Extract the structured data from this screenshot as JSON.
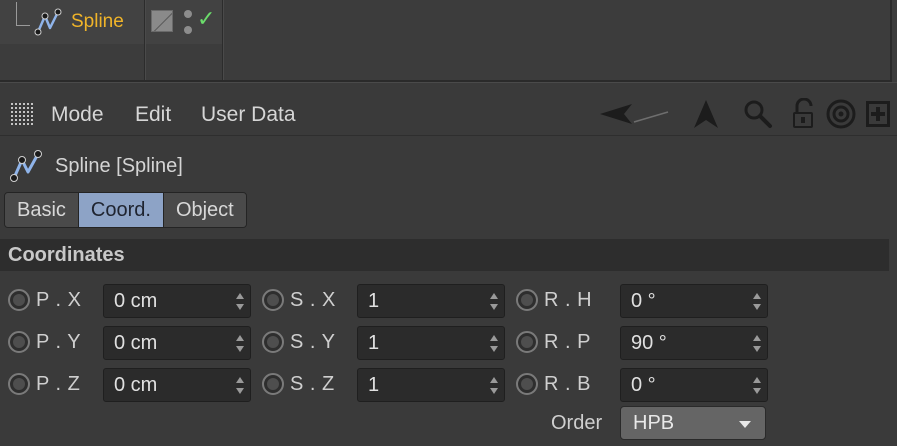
{
  "object_manager": {
    "object_name": "Spline",
    "icons": [
      "spline-icon",
      "layer-icon",
      "visibility-dots-icon",
      "enabled-check-icon"
    ],
    "check_glyph": "✓"
  },
  "toolbar": {
    "menu": [
      "Mode",
      "Edit",
      "User Data"
    ],
    "icons": [
      "back-arrow-icon",
      "up-arrow-icon",
      "search-icon",
      "lock-icon",
      "target-icon",
      "new-manager-icon"
    ]
  },
  "object_header": {
    "title": "Spline [Spline]"
  },
  "tabs": [
    {
      "label": "Basic",
      "active": false
    },
    {
      "label": "Coord.",
      "active": true
    },
    {
      "label": "Object",
      "active": false
    }
  ],
  "section": {
    "title": "Coordinates"
  },
  "params": {
    "position": [
      {
        "label": "P . X",
        "value": "0 cm"
      },
      {
        "label": "P . Y",
        "value": "0 cm"
      },
      {
        "label": "P . Z",
        "value": "0 cm"
      }
    ],
    "scale": [
      {
        "label": "S . X",
        "value": "1"
      },
      {
        "label": "S . Y",
        "value": "1"
      },
      {
        "label": "S . Z",
        "value": "1"
      }
    ],
    "rotation": [
      {
        "label": "R . H",
        "value": "0 °"
      },
      {
        "label": "R . P",
        "value": "90 °"
      },
      {
        "label": "R . B",
        "value": "0 °"
      }
    ]
  },
  "order": {
    "label": "Order",
    "value": "HPB"
  },
  "colors": {
    "object_name": "#f0b429",
    "active_tab": "#8da3c6",
    "check": "#6bdc6b",
    "background": "#3a3a3a"
  }
}
